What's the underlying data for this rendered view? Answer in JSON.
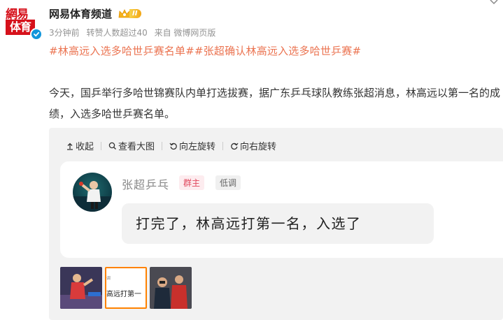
{
  "post": {
    "author": {
      "name": "网易体育频道",
      "vip_level": "II",
      "logo_top": "網易",
      "logo_bottom": "体育"
    },
    "meta": {
      "time": "3分钟前",
      "reposts": "转赞人数超过40",
      "source": "来自 微博网页版"
    },
    "tags": "#林高远入选多哈世乒赛名单##张超确认林高远入选多哈世乒赛#",
    "text": "今天，国乒举行多哈世锦赛队内单打选拔赛，据广东乒乓球队教练张超消息，林高远以第一名的成绩，入选多哈世乒赛名单。"
  },
  "media": {
    "toolbar": {
      "collapse_label": "收起",
      "view_large_label": "查看大图",
      "rotate_left_label": "向左旋转",
      "rotate_right_label": "向右旋转"
    },
    "screenshot": {
      "user": "张超乒乓",
      "role_badge": "群主",
      "level_badge": "低调",
      "message": "打完了，林高远打第一名，入选了"
    },
    "thumbnails": [
      {
        "name": "thumb-1",
        "text": ""
      },
      {
        "name": "thumb-2",
        "text": "高远打第一",
        "small": "调"
      },
      {
        "name": "thumb-3",
        "text": ""
      }
    ]
  },
  "colors": {
    "accent": "#eb7350",
    "brand_red": "#d6111b",
    "active_thumb": "#ff8200",
    "verified": "#1296db"
  }
}
